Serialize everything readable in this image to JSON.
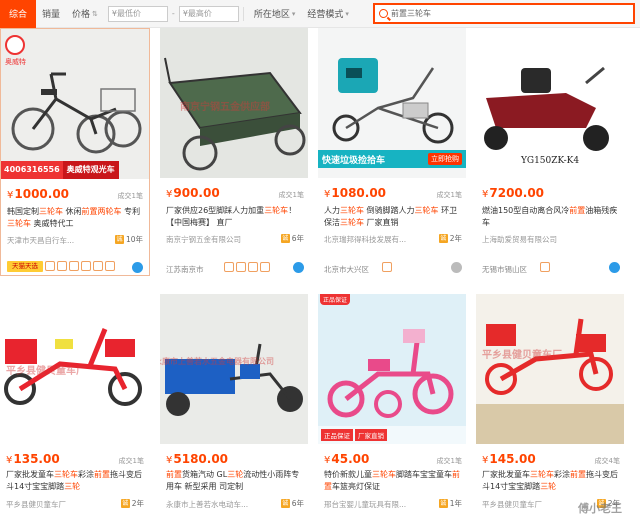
{
  "filters": {
    "tabs": [
      "综合",
      "销量",
      "价格"
    ],
    "price_min_placeholder": "¥最低价",
    "price_max_placeholder": "¥最高价",
    "location": "所在地区",
    "mode": "经营模式",
    "search_value": "前置三轮车"
  },
  "colors": {
    "accent": "#ff4400",
    "tmall_yellow": "#ffcc33",
    "wangwang": "#2c9be8"
  },
  "products": [
    {
      "price": "1000.00",
      "sales": "成交1笔",
      "title": [
        "韩国定制",
        "三轮车",
        " 休闲",
        "前置",
        "两轮车",
        " 专利",
        "三轮车",
        " 奥威特代工"
      ],
      "shop": "天津市天昌自行车...",
      "years": "10年",
      "location": "",
      "img_phone": "4006316556",
      "img_brand": "奥威特观光车",
      "img_logo": "奥威特",
      "badge_tmall": "天猫天选"
    },
    {
      "price": "900.00",
      "sales": "成交1笔",
      "title": [
        "厂家供应26型脚踩人力加重",
        "三轮车",
        "！【中国梅赛】 直厂"
      ],
      "shop": "南京宁钢五金有限公司",
      "years": "6年",
      "location": "江苏南京市",
      "img_watermark": "南京宁钢五金供应部"
    },
    {
      "price": "1080.00",
      "sales": "成交1笔",
      "title": [
        "人力",
        "三轮车",
        " 倒骑脚踏人力",
        "三轮车",
        " 环卫保洁",
        "三轮车",
        " 厂家直销"
      ],
      "shop": "北京瑞邦得科技发展有...",
      "years": "2年",
      "location": "北京市大兴区",
      "img_banner": "快速垃圾捡拾车",
      "img_banner_btn": "立即抢购"
    },
    {
      "price": "7200.00",
      "sales": "",
      "title": [
        "燃油150型自动离合风冷",
        "前置",
        "油箱残疾车"
      ],
      "shop": "上海助爱贸易有限公司",
      "years": "",
      "location": "无锡市锡山区",
      "img_model": "YG150ZK-K4"
    },
    {
      "price": "135.00",
      "sales": "成交1笔",
      "title": [
        "厂家批发童车",
        "三轮车",
        "彩涂",
        "前置",
        "拖斗变后斗14寸宝宝脚踏",
        "三轮"
      ],
      "shop": "平乡县健贝童车厂",
      "years": "2年",
      "location": "",
      "img_watermark": "平乡县健贝童车厂"
    },
    {
      "price": "5180.00",
      "sales": "",
      "title": [
        "前置",
        "货箱汽动 GL",
        "三轮",
        "流动性小雨阵专用车 新型采用 司定制"
      ],
      "shop": "永康市上善若水电动车...",
      "years": "6年",
      "location": "",
      "img_watermark": "永康市上善若水五金电器有限公司"
    },
    {
      "price": "45.00",
      "sales": "成交1笔",
      "title": [
        "特价新款儿童",
        "三轮车",
        "脚踏车宝宝童车",
        "前置",
        "车篮亮灯保证"
      ],
      "shop": "邢台宝婴儿童玩具有限...",
      "years": "1年",
      "location": "",
      "img_flag": "正品保证",
      "img_promo": [
        "正品保证",
        "厂家直销"
      ]
    },
    {
      "price": "145.00",
      "sales": "成交4笔",
      "title": [
        "厂家批发童车",
        "三轮车",
        "彩涂",
        "前置",
        "拖斗变后斗14寸宝宝脚踏",
        "三轮"
      ],
      "shop": "平乡县健贝童车厂",
      "years": "2年",
      "location": "",
      "img_watermark": "平乡县健贝童车厂",
      "img_wechat": "傅小老王"
    }
  ]
}
